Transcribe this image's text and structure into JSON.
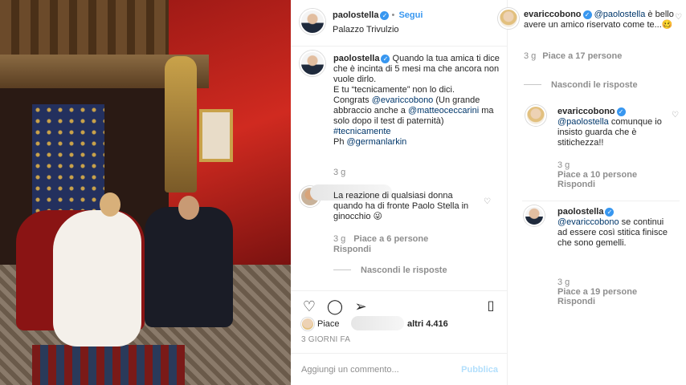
{
  "post": {
    "header": {
      "username": "paolostella",
      "follow_label": "Segui",
      "location": "Palazzo Trivulzio"
    },
    "caption": {
      "username": "paolostella",
      "line1": "Quando la tua amica ti dice che è incinta di 5 mesi ma che ancora non vuole dirlo.",
      "line2": "E tu “tecnicamente” non lo dici.",
      "line3_pre": "Congrats ",
      "mention1": "@evariccobono",
      "line3_post": " (Un grande abbraccio anche a ",
      "mention2": "@matteoceccarini",
      "line4": " ma solo dopo il test di paternità)",
      "hashtag": "#tecnicamente",
      "credit_pre": "Ph ",
      "mention3": "@germanlarkin",
      "time": "3 g"
    },
    "comment1": {
      "text": "La reazione di qualsiasi donna quando ha di fronte Paolo Stella in ginocchio 😜",
      "time": "3 g",
      "likes": "Piace a 6 persone",
      "reply": "Rispondi",
      "hide_replies": "Nascondi le risposte"
    },
    "likes": {
      "label": "Piace",
      "rest": "altri 4.416"
    },
    "date": "3 GIORNI FA",
    "add_comment_placeholder": "Aggiungi un commento...",
    "publish_label": "Pubblica"
  },
  "right": {
    "c1": {
      "username": "evariccobono",
      "mention": "@paolostella",
      "text": " è bello avere un amico riservato come te...🥴",
      "time": "3 g",
      "likes": "Piace a 17 persone",
      "hide_replies": "Nascondi le risposte"
    },
    "c2": {
      "username": "evariccobono",
      "mention": "@paolostella",
      "text": " comunque io insisto guarda che è stitichezza!!",
      "time": "3 g",
      "likes": "Piace a 10 persone",
      "reply": "Rispondi"
    },
    "c3": {
      "username": "paolostella",
      "mention": "@evariccobono",
      "text": " se continui ad essere così stitica finisce che sono gemelli.",
      "time": "3 g",
      "likes": "Piace a 19 persone",
      "reply": "Rispondi"
    }
  },
  "icons": {
    "heart": "heart-icon",
    "comment": "comment-icon",
    "share": "share-icon",
    "save": "bookmark-icon",
    "verified": "verified-badge-icon"
  },
  "colors": {
    "accent_blue": "#3897f0",
    "mention_blue": "#00376b",
    "grey_text": "#8e8e8e",
    "publish_disabled": "#b2dffc"
  }
}
